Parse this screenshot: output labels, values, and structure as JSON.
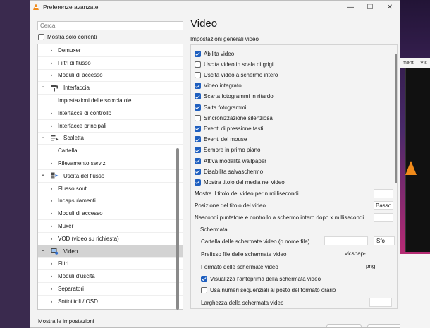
{
  "window": {
    "title": "Preferenze avanzate",
    "minimize": "—",
    "maximize": "☐",
    "close": "✕"
  },
  "left": {
    "search_placeholder": "Cerca",
    "show_current_label": "Mostra solo correnti",
    "show_current_checked": false,
    "tree": [
      {
        "label": "Demuxer",
        "level": 1,
        "expanded": false,
        "icon": null
      },
      {
        "label": "Filtri di flusso",
        "level": 1,
        "expanded": false,
        "icon": null
      },
      {
        "label": "Moduli di accesso",
        "level": 1,
        "expanded": false,
        "icon": null
      },
      {
        "label": "Interfaccia",
        "level": 0,
        "expanded": true,
        "icon": "paint-roller-icon"
      },
      {
        "label": "Impostazioni delle scorciatoie",
        "level": 1,
        "leaf": true,
        "icon": null
      },
      {
        "label": "Interfacce di controllo",
        "level": 1,
        "expanded": false,
        "icon": null
      },
      {
        "label": "Interfacce principali",
        "level": 1,
        "expanded": false,
        "icon": null
      },
      {
        "label": "Scaletta",
        "level": 0,
        "expanded": true,
        "icon": "playlist-icon"
      },
      {
        "label": "Cartella",
        "level": 1,
        "leaf": true,
        "icon": null
      },
      {
        "label": "Rilevamento servizi",
        "level": 1,
        "expanded": false,
        "icon": null
      },
      {
        "label": "Uscita del flusso",
        "level": 0,
        "expanded": true,
        "icon": "stream-output-icon"
      },
      {
        "label": "Flusso sout",
        "level": 1,
        "expanded": false,
        "icon": null
      },
      {
        "label": "Incapsulamenti",
        "level": 1,
        "expanded": false,
        "icon": null
      },
      {
        "label": "Moduli di accesso",
        "level": 1,
        "expanded": false,
        "icon": null
      },
      {
        "label": "Muxer",
        "level": 1,
        "expanded": false,
        "icon": null
      },
      {
        "label": "VOD (video su richiesta)",
        "level": 1,
        "expanded": false,
        "icon": null
      },
      {
        "label": "Video",
        "level": 0,
        "expanded": true,
        "selected": true,
        "icon": "video-settings-icon"
      },
      {
        "label": "Filtri",
        "level": 1,
        "expanded": false,
        "icon": null
      },
      {
        "label": "Moduli d'uscita",
        "level": 1,
        "expanded": false,
        "icon": null
      },
      {
        "label": "Separatori",
        "level": 1,
        "expanded": false,
        "icon": null
      },
      {
        "label": "Sottotitoli / OSD",
        "level": 1,
        "expanded": false,
        "icon": null
      }
    ],
    "show_settings_label": "Mostra le impostazioni"
  },
  "right": {
    "title": "Video",
    "section": "Impostazioni generali  video",
    "options": [
      {
        "label": "Abilita video",
        "checked": true
      },
      {
        "label": "Uscita video in scala di grigi",
        "checked": false
      },
      {
        "label": "Uscita video a schermo intero",
        "checked": false
      },
      {
        "label": "Video integrato",
        "checked": true
      },
      {
        "label": "Scarta fotogrammi in ritardo",
        "checked": true
      },
      {
        "label": "Salta fotogrammi",
        "checked": true
      },
      {
        "label": "Sincronizzazione silenziosa",
        "checked": false
      },
      {
        "label": "Eventi di pressione tasti",
        "checked": true
      },
      {
        "label": "Eventi del mouse",
        "checked": true
      },
      {
        "label": "Sempre in primo piano",
        "checked": true
      },
      {
        "label": "Attiva modalità wallpaper",
        "checked": true
      },
      {
        "label": "Disabilita salvaschermo",
        "checked": true
      },
      {
        "label": "Mostra titolo del media nel video",
        "checked": true
      }
    ],
    "fields": [
      {
        "label": "Mostra il titolo del video per n millisecondi",
        "value": ""
      },
      {
        "label": "Posizione del titolo del video",
        "value": "Basso"
      },
      {
        "label": "Nascondi puntatore e controllo a schermo intero dopo x millisecondi",
        "value": ""
      }
    ],
    "snapshot": {
      "title": "Schermata",
      "folder_label": "Cartella delle schermate video (o nome file)",
      "folder_value": "",
      "browse_label": "Sfo",
      "prefix_label": "Prefisso file delle schermate video",
      "prefix_value": "vlcsnap-",
      "format_label": "Formato delle schermate video",
      "format_value": "png",
      "preview_label": "Visualizza l'anteprima della schermata video",
      "preview_checked": true,
      "sequential_label": "Usa numeri sequenziali al posto del formato orario",
      "sequential_checked": false,
      "width_label": "Larghezza della schermata video",
      "width_value": ""
    }
  },
  "background": {
    "menu_items": [
      "menti",
      "Vis"
    ]
  }
}
